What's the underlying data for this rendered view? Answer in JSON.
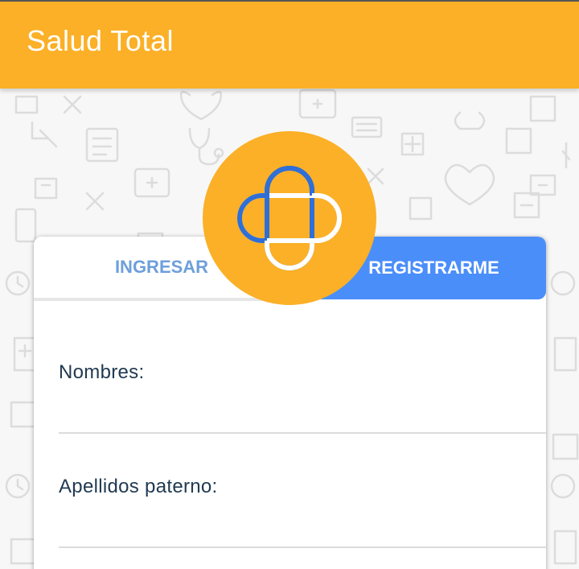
{
  "app": {
    "title": "Salud Total",
    "accent_color": "#fbb027",
    "tab_active_color": "#4a8ef9"
  },
  "logo": {
    "icon": "medical-cross-bandage-icon"
  },
  "tabs": [
    {
      "label": "INGRESAR",
      "active": false
    },
    {
      "label": "REGISTRARME",
      "active": true
    }
  ],
  "form": {
    "fields": [
      {
        "label": "Nombres:",
        "value": ""
      },
      {
        "label": "Apellidos paterno:",
        "value": ""
      }
    ]
  }
}
